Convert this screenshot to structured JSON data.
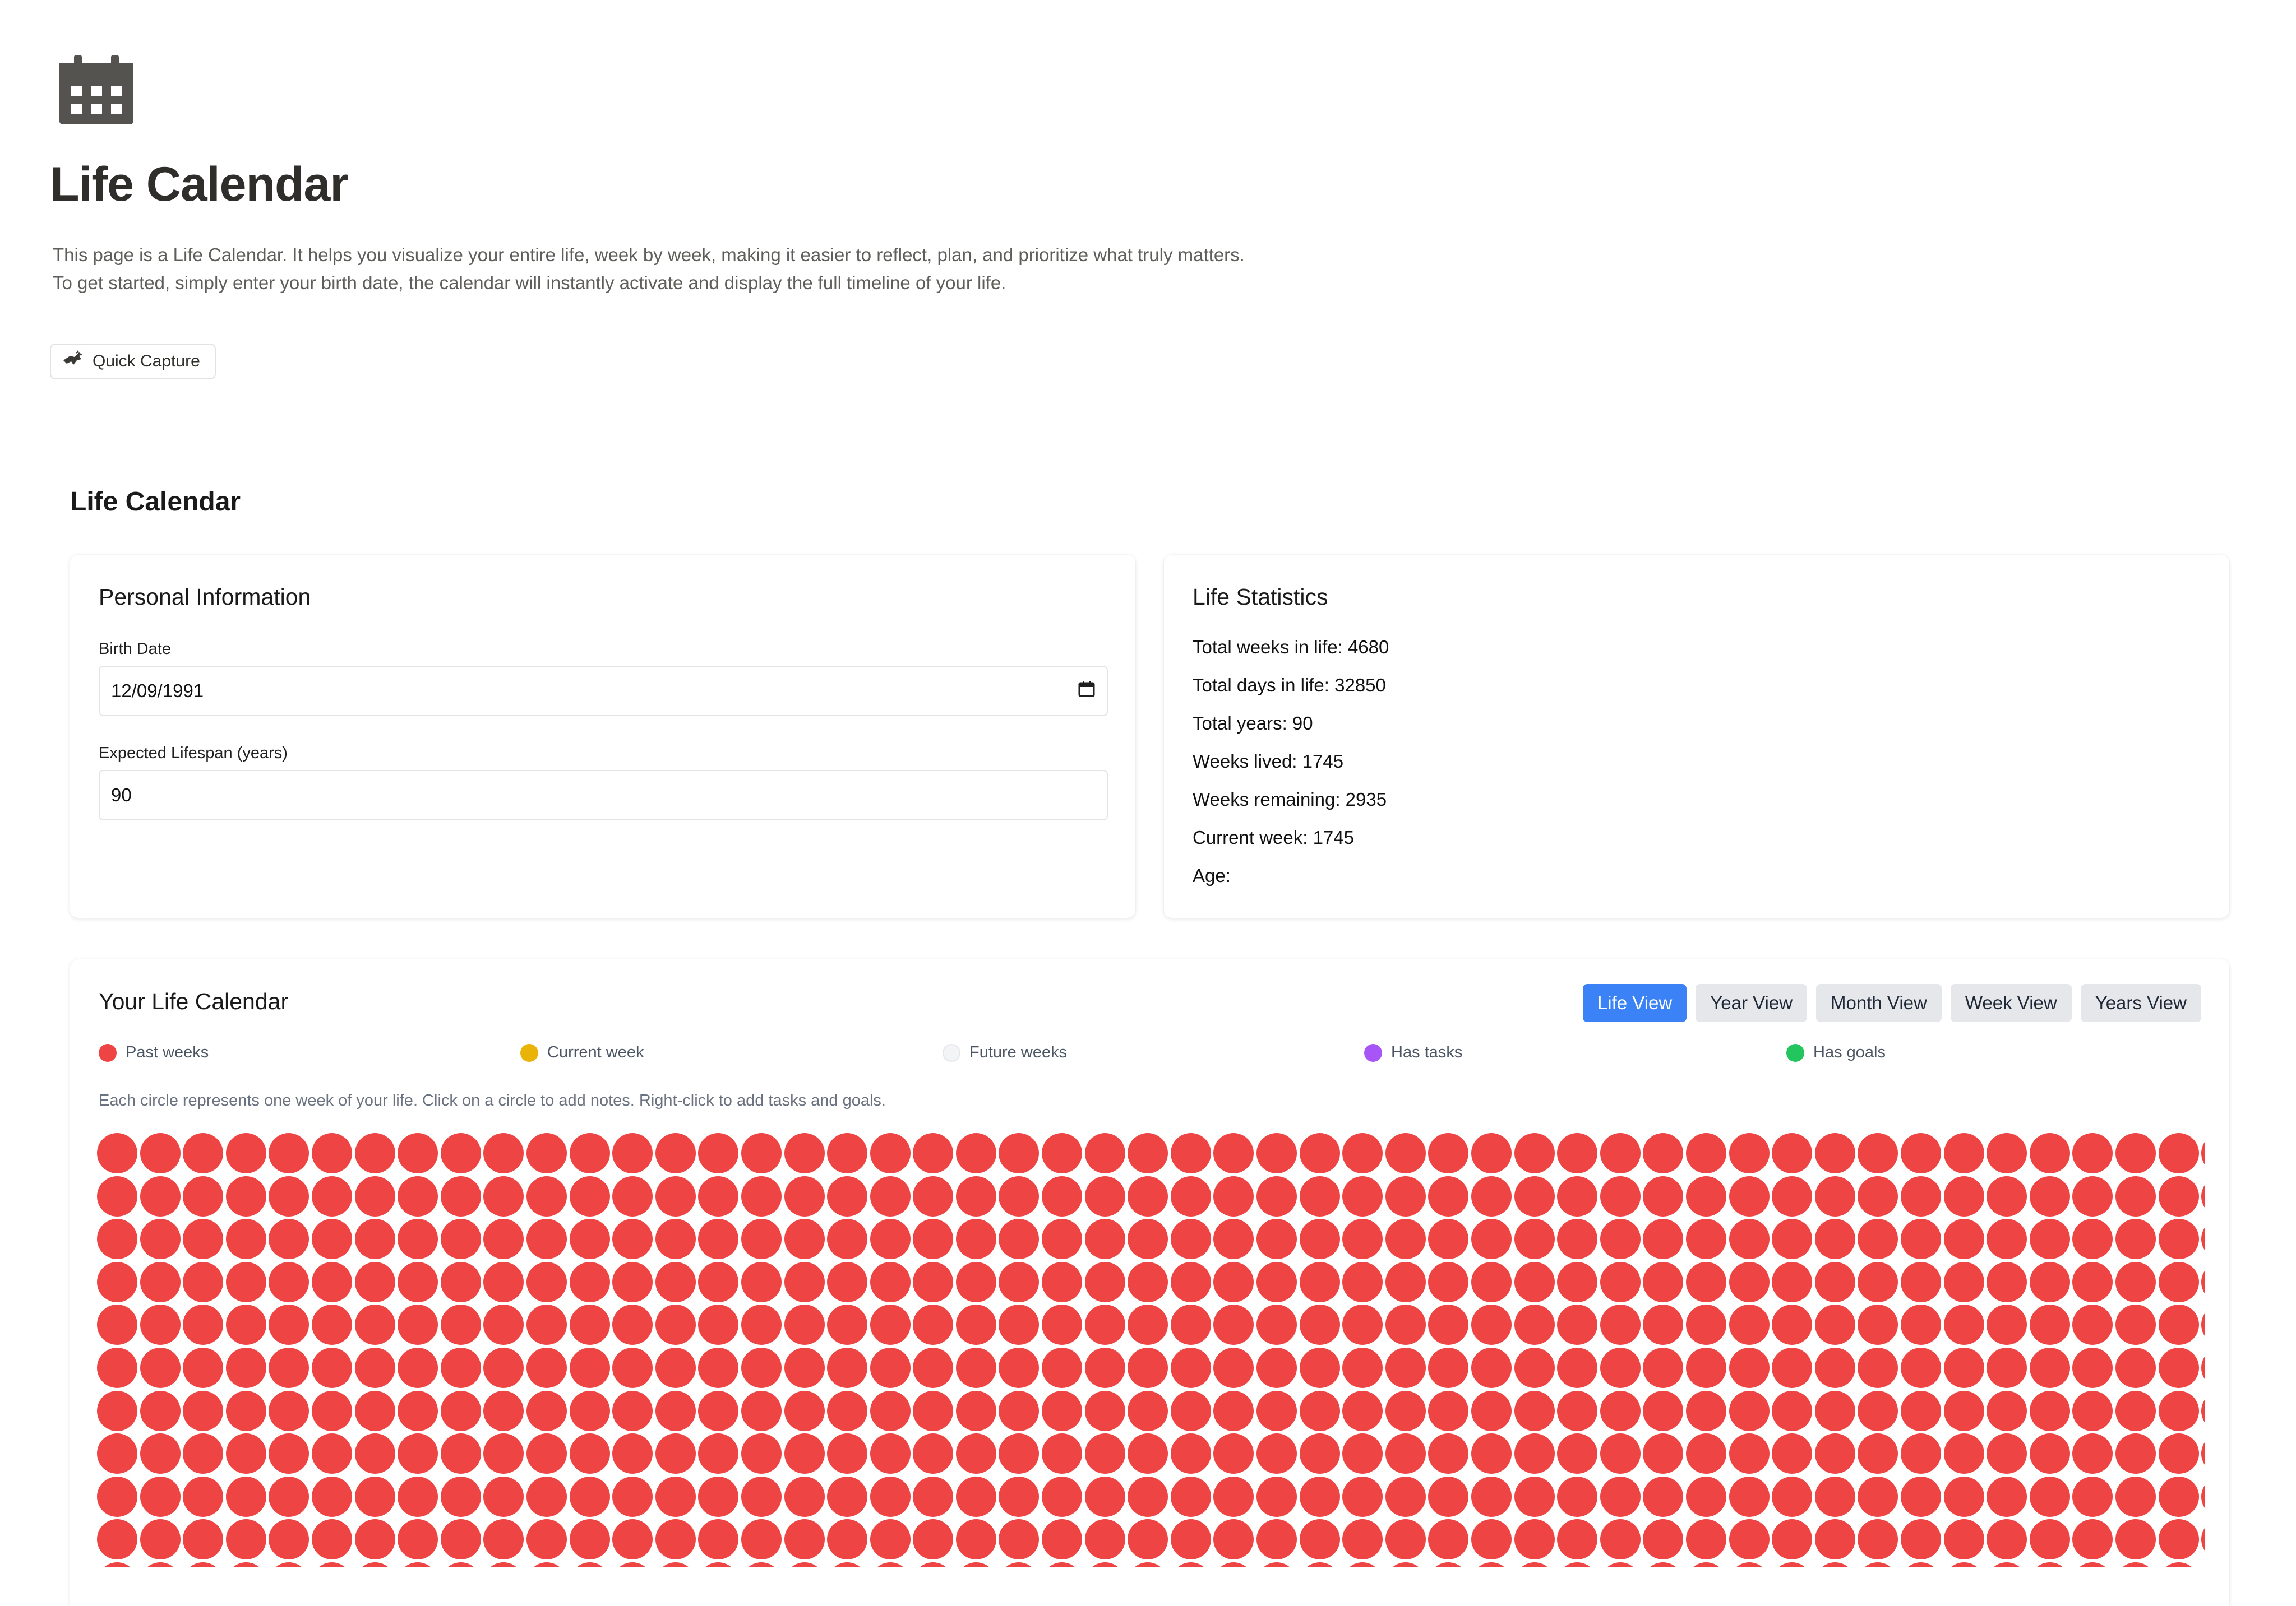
{
  "page": {
    "icon": "calendar-icon",
    "title": "Life Calendar",
    "intro_lines": [
      "This page is a Life Calendar. It helps you visualize your entire life, week by week, making it easier to reflect, plan, and prioritize what truly matters.",
      "To get started, simply enter your birth date, the calendar will instantly activate and display the full timeline of your life."
    ],
    "quick_capture": {
      "icon": "bird-icon",
      "label": "Quick Capture"
    }
  },
  "section": {
    "heading": "Life Calendar"
  },
  "personal": {
    "title": "Personal Information",
    "birth_date": {
      "label": "Birth Date",
      "value": "12/09/1991",
      "icon": "calendar-picker-icon"
    },
    "lifespan": {
      "label": "Expected Lifespan (years)",
      "value": "90"
    }
  },
  "stats": {
    "title": "Life Statistics",
    "items": [
      "Total weeks in life: 4680",
      "Total days in life: 32850",
      "Total years: 90",
      "Weeks lived: 1745",
      "Weeks remaining: 2935",
      "Current week: 1745",
      "Age:"
    ]
  },
  "calendar": {
    "title": "Your Life Calendar",
    "tabs": [
      {
        "label": "Life View",
        "active": true
      },
      {
        "label": "Year View",
        "active": false
      },
      {
        "label": "Month View",
        "active": false
      },
      {
        "label": "Week View",
        "active": false
      },
      {
        "label": "Years View",
        "active": false
      }
    ],
    "legend": [
      {
        "label": "Past weeks",
        "color": "#ef4444"
      },
      {
        "label": "Current week",
        "color": "#eab308"
      },
      {
        "label": "Future weeks",
        "color": "#f3f4f6"
      },
      {
        "label": "Has tasks",
        "color": "#a855f7"
      },
      {
        "label": "Has goals",
        "color": "#22c55e"
      }
    ],
    "hint": "Each circle represents one week of your life. Click on a circle to add notes. Right-click to add tasks and goals.",
    "weeks_per_row": 52,
    "weeks_lived": 1745,
    "visible_rows": 11
  }
}
